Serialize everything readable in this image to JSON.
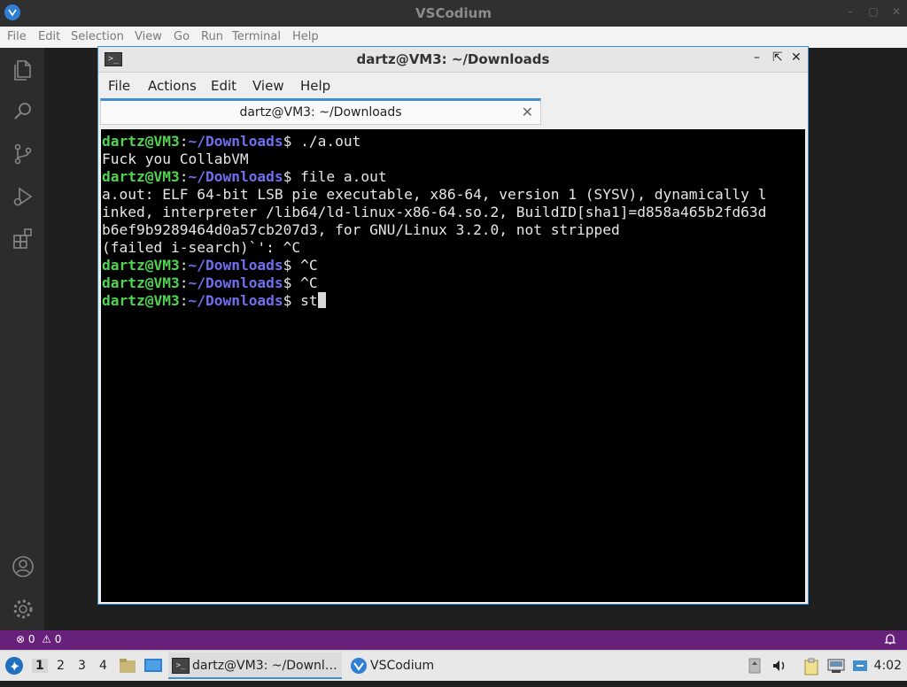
{
  "vscodium": {
    "title": "VSCodium",
    "menu": [
      "File",
      "Edit",
      "Selection",
      "View",
      "Go",
      "Run",
      "Terminal",
      "Help"
    ],
    "activity_icons": [
      "files-icon",
      "search-icon",
      "source-control-icon",
      "run-debug-icon",
      "extensions-icon",
      "account-icon",
      "settings-gear-icon"
    ],
    "status": {
      "errors": "0",
      "warnings": "0"
    }
  },
  "terminal": {
    "title": "dartz@VM3: ~/Downloads",
    "menu": [
      "File",
      "Actions",
      "Edit",
      "View",
      "Help"
    ],
    "tab_label": "dartz@VM3: ~/Downloads",
    "prompt": {
      "user": "dartz@VM3",
      "colon": ":",
      "path": "~/Downloads",
      "sign": "$ "
    },
    "lines": [
      {
        "prompt": true,
        "text": "./a.out"
      },
      {
        "prompt": false,
        "text": "Fuck you CollabVM"
      },
      {
        "prompt": true,
        "text": "file a.out"
      },
      {
        "prompt": false,
        "text": "a.out: ELF 64-bit LSB pie executable, x86-64, version 1 (SYSV), dynamically l"
      },
      {
        "prompt": false,
        "text": "inked, interpreter /lib64/ld-linux-x86-64.so.2, BuildID[sha1]=d858a465b2fd63d"
      },
      {
        "prompt": false,
        "text": "b6ef9b9289464d0a57cb207d3, for GNU/Linux 3.2.0, not stripped"
      },
      {
        "prompt": false,
        "text": "(failed i-search)`': ^C"
      },
      {
        "prompt": true,
        "text": "^C"
      },
      {
        "prompt": true,
        "text": "^C"
      },
      {
        "prompt": true,
        "text": "st"
      }
    ]
  },
  "taskbar": {
    "workspaces": [
      "1",
      "2",
      "3",
      "4"
    ],
    "active_workspace": "1",
    "tasks": [
      {
        "label": "dartz@VM3: ~/Downl…",
        "icon": "terminal-icon"
      },
      {
        "label": "VSCodium",
        "icon": "vscodium-icon"
      }
    ],
    "clock": "4:02"
  }
}
